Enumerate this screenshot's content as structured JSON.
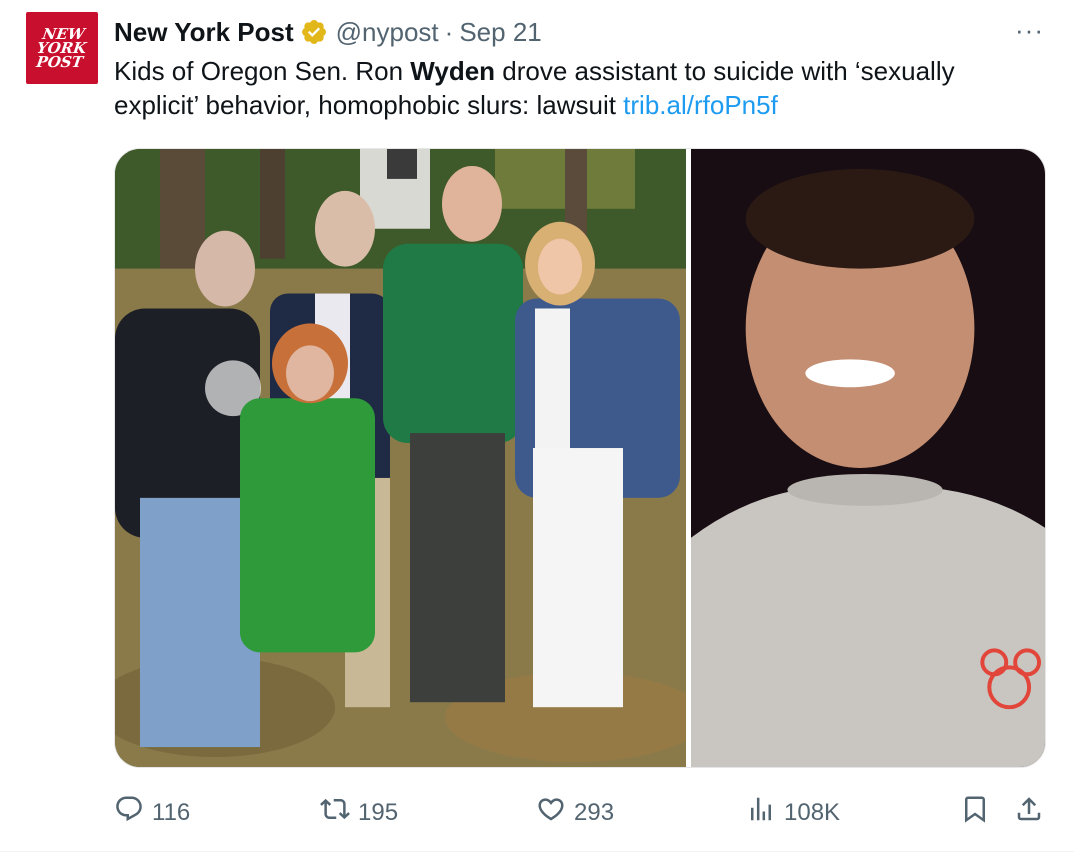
{
  "account": {
    "avatar_text": "NEW\nYORK\nPOST",
    "display_name": "New York Post",
    "handle": "@nypost",
    "separator": "·",
    "date": "Sep 21"
  },
  "tweet": {
    "text_before": "Kids of Oregon Sen. Ron ",
    "text_bold": "Wyden",
    "text_after": " drove assistant to suicide with ‘sexually explicit’ behavior, homophobic slurs: lawsuit ",
    "link": "trib.al/rfoPn5f"
  },
  "menu": {
    "more": "···"
  },
  "actions": {
    "replies": "116",
    "reposts": "195",
    "likes": "293",
    "views": "108K"
  },
  "icons": {
    "verified": "verified-badge-icon",
    "reply": "reply-icon",
    "repost": "repost-icon",
    "like": "heart-icon",
    "views": "views-icon",
    "bookmark": "bookmark-icon",
    "share": "share-icon"
  },
  "colors": {
    "brand_red": "#c8102e",
    "link": "#1d9bf0",
    "verified_gold": "#e2b719",
    "secondary_text": "#536471"
  }
}
